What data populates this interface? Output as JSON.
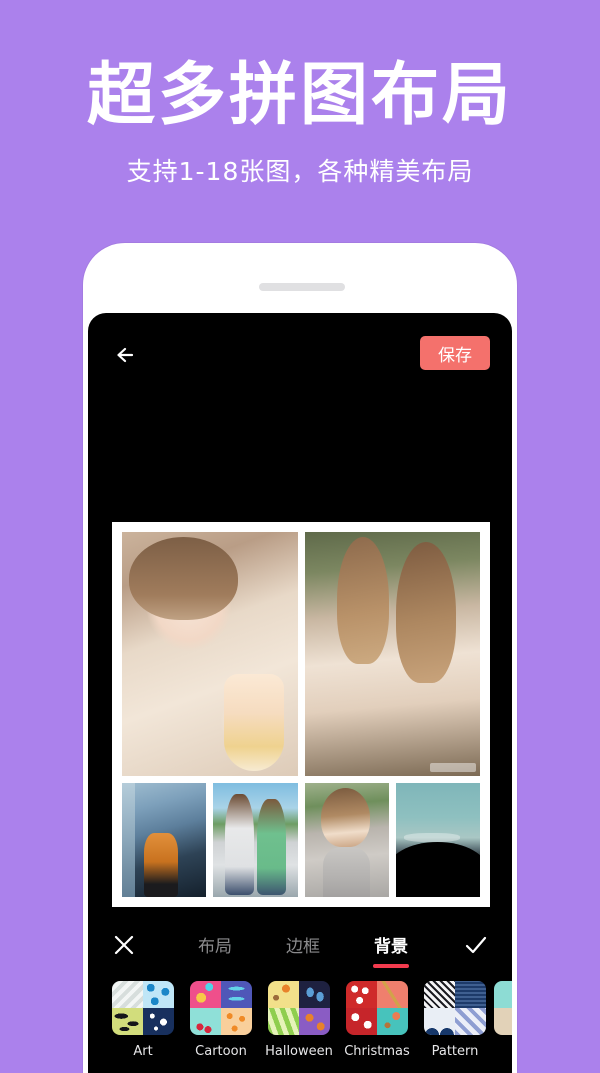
{
  "promo": {
    "title": "超多拼图布局",
    "subtitle": "支持1-18张图，各种精美布局",
    "background_color": "#ab81ec",
    "text_color": "#ffffff"
  },
  "phone": {
    "screen_background": "#000000"
  },
  "app": {
    "topbar": {
      "back_icon": "arrow-left-icon",
      "save_label": "保存",
      "save_color": "#f4716c"
    },
    "collage": {
      "frame_color": "#ffffff",
      "rows": [
        {
          "cells": [
            {
              "name": "photo-girl-with-drink",
              "style": "ph1"
            },
            {
              "name": "photo-two-girls-outdoors",
              "style": "ph2",
              "watermark": true
            }
          ]
        },
        {
          "cells": [
            {
              "name": "photo-street-portrait",
              "style": "ph3"
            },
            {
              "name": "photo-two-girls-sunglasses",
              "style": "ph4"
            },
            {
              "name": "photo-girl-grey-top",
              "style": "ph5"
            },
            {
              "name": "photo-mountain-dusk",
              "style": "ph6"
            }
          ]
        }
      ]
    },
    "tabbar": {
      "close_icon": "close-icon",
      "check_icon": "check-icon",
      "active_underline_color": "#f23b4e",
      "tabs": [
        {
          "label": "布局",
          "active": false
        },
        {
          "label": "边框",
          "active": false
        },
        {
          "label": "背景",
          "active": true
        }
      ]
    },
    "backgrounds": [
      {
        "label": "Art",
        "quadrants": [
          "p-chevron",
          "p-circles",
          "p-blobs",
          "p-stars"
        ]
      },
      {
        "label": "Cartoon",
        "quadrants": [
          "p-pink",
          "p-bones",
          "p-cherry",
          "p-suns"
        ]
      },
      {
        "label": "Halloween",
        "quadrants": [
          "p-pumpkin",
          "p-ghost",
          "p-greenstripe",
          "p-purple"
        ]
      },
      {
        "label": "Christmas",
        "quadrants": [
          "p-santa",
          "p-wheat",
          "p-redstar",
          "p-teal"
        ]
      },
      {
        "label": "Pattern",
        "quadrants": [
          "p-geo",
          "p-navytex",
          "p-fans",
          "p-diamond"
        ]
      },
      {
        "label": "",
        "partial": true,
        "quadrants": [
          "p-mint",
          "p-beige"
        ]
      }
    ]
  }
}
